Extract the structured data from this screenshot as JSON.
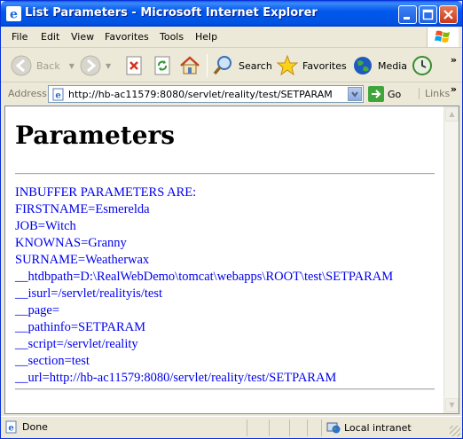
{
  "window": {
    "title": "List Parameters - Microsoft Internet Explorer"
  },
  "menu": [
    "File",
    "Edit",
    "View",
    "Favorites",
    "Tools",
    "Help"
  ],
  "toolbar": {
    "back_label": "Back",
    "search_label": "Search",
    "favorites_label": "Favorites",
    "media_label": "Media"
  },
  "address": {
    "label": "Address",
    "url": "http://hb-ac11579:8080/servlet/reality/test/SETPARAM",
    "go_label": "Go",
    "links_label": "Links"
  },
  "page": {
    "heading": "Parameters",
    "lines": [
      "INBUFFER PARAMETERS ARE:",
      "FIRSTNAME=Esmerelda",
      "JOB=Witch",
      "KNOWNAS=Granny",
      "SURNAME=Weatherwax",
      "__htdbpath=D:\\RealWebDemo\\tomcat\\webapps\\ROOT\\test\\SETPARAM",
      "__isurl=/servlet/realityis/test",
      "__page=",
      "__pathinfo=SETPARAM",
      "__script=/servlet/reality",
      "__section=test",
      "__url=http://hb-ac11579:8080/servlet/reality/test/SETPARAM"
    ]
  },
  "status": {
    "text": "Done",
    "zone": "Local intranet"
  },
  "colors": {
    "titlebar": "#0058EE",
    "link_text": "#0000EE",
    "chrome": "#ECE9D8"
  }
}
